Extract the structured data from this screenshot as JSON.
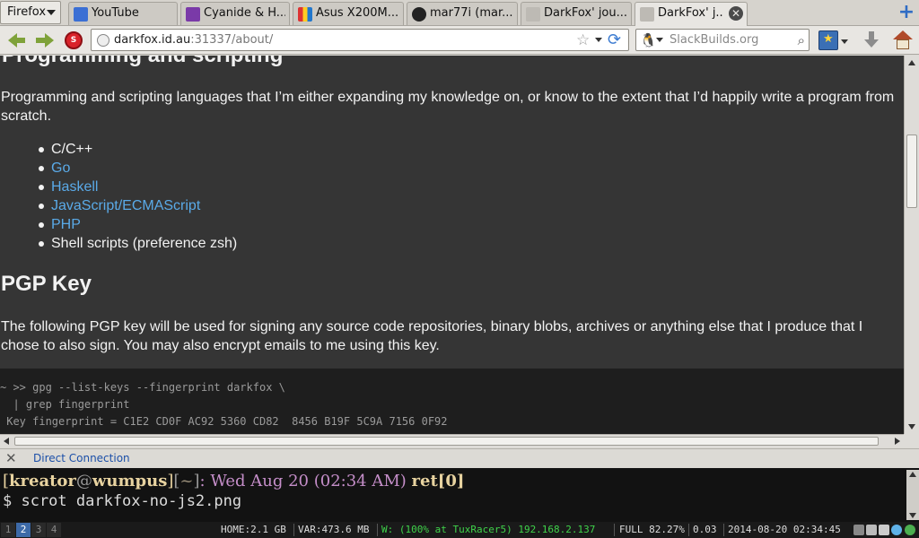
{
  "browser": {
    "menu_label": "Firefox",
    "tabs": [
      {
        "label": "YouTube"
      },
      {
        "label": "Cyanide & H..."
      },
      {
        "label": "Asus X200M..."
      },
      {
        "label": "mar77i (mar..."
      },
      {
        "label": "DarkFox' jou..."
      },
      {
        "label": "DarkFox' j..."
      }
    ],
    "url_host": "darkfox.id.au",
    "url_rest": ":31337/about/",
    "search_placeholder": "SlackBuilds.org"
  },
  "page": {
    "heading_top": "Programming and scripting",
    "para1": "Programming and scripting languages that I’m either expanding my knowledge on, or know to the extent that I’d happily write a program from scratch.",
    "languages": [
      {
        "label": "C/C++",
        "link": false
      },
      {
        "label": "Go",
        "link": true
      },
      {
        "label": "Haskell",
        "link": true
      },
      {
        "label": "JavaScript/ECMAScript",
        "link": true
      },
      {
        "label": "PHP",
        "link": true
      },
      {
        "label": "Shell scripts (preference zsh)",
        "link": false
      }
    ],
    "pgp_heading": "PGP Key",
    "para2": "The following PGP key will be used for signing any source code repositories, binary blobs, archives or anything else that I produce that I chose to also sign. You may also encrypt emails to me using this key.",
    "code_lines": [
      "~ >> gpg --list-keys --fingerprint darkfox \\",
      "  | grep fingerprint",
      " Key fingerprint = C1E2 CD0F AC92 5360 CD82  8456 B19F 5C9A 7156 0F92"
    ]
  },
  "status": {
    "connection": "Direct Connection"
  },
  "terminal": {
    "user": "kreator",
    "at": "@",
    "host": "wumpus",
    "path": "~",
    "date": "Wed Aug 20 (02:34 AM)",
    "ret_label": "ret",
    "ret_value": "0",
    "command": "$ scrot darkfox-no-js2.png"
  },
  "panel": {
    "workspaces": [
      "1",
      "2",
      "3",
      "4"
    ],
    "current_workspace": "2",
    "home": "HOME:2.1 GB",
    "var": "VAR:473.6 MB",
    "wifi": "W: (100% at TuxRacer5) 192.168.2.137",
    "battery": "FULL 82.27%",
    "load": "0.03",
    "datetime": "2014-08-20 02:34:45"
  },
  "colors": {
    "page_bg": "#353535",
    "link": "#5aaae8",
    "wifi_green": "#3fd34a",
    "active_ws": "#3d6aa8"
  }
}
